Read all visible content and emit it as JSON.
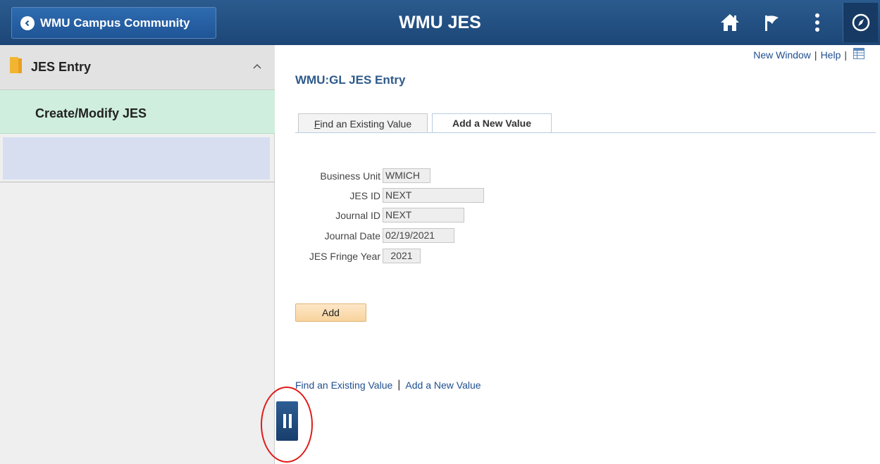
{
  "header": {
    "back_label": "WMU Campus Community",
    "title": "WMU JES",
    "icons": [
      "home-icon",
      "flag-icon",
      "more-vertical-icon",
      "compass-icon"
    ]
  },
  "sidebar": {
    "folder_label": "JES Entry",
    "active_item": "Create/Modify JES"
  },
  "top_links": {
    "new_window": "New Window",
    "separator": "|",
    "help": "Help"
  },
  "page": {
    "title": "WMU:GL JES Entry",
    "tabs": [
      {
        "label": "Find an Existing Value",
        "accesskey": "F",
        "rest": "ind an Existing Value",
        "active": false
      },
      {
        "label": "Add a New Value",
        "active": true
      }
    ],
    "fields": {
      "business_unit": {
        "label": "Business Unit",
        "value": "WMICH"
      },
      "jes_id": {
        "label": "JES ID",
        "value": "NEXT"
      },
      "journal_id": {
        "label": "Journal ID",
        "value": "NEXT"
      },
      "journal_date": {
        "label": "Journal Date",
        "value": "02/19/2021"
      },
      "fringe_year": {
        "label": "JES Fringe Year",
        "value": "2021"
      }
    },
    "add_button": "Add",
    "bottom_links": {
      "find": "Find an Existing Value",
      "separator": "|",
      "add": "Add a New Value"
    }
  },
  "colors": {
    "header": "#1c4677",
    "active_item": "#cfeedd",
    "link": "#1f4f8f",
    "add_button": "#f8d39d",
    "highlight": "#e01b1b"
  }
}
